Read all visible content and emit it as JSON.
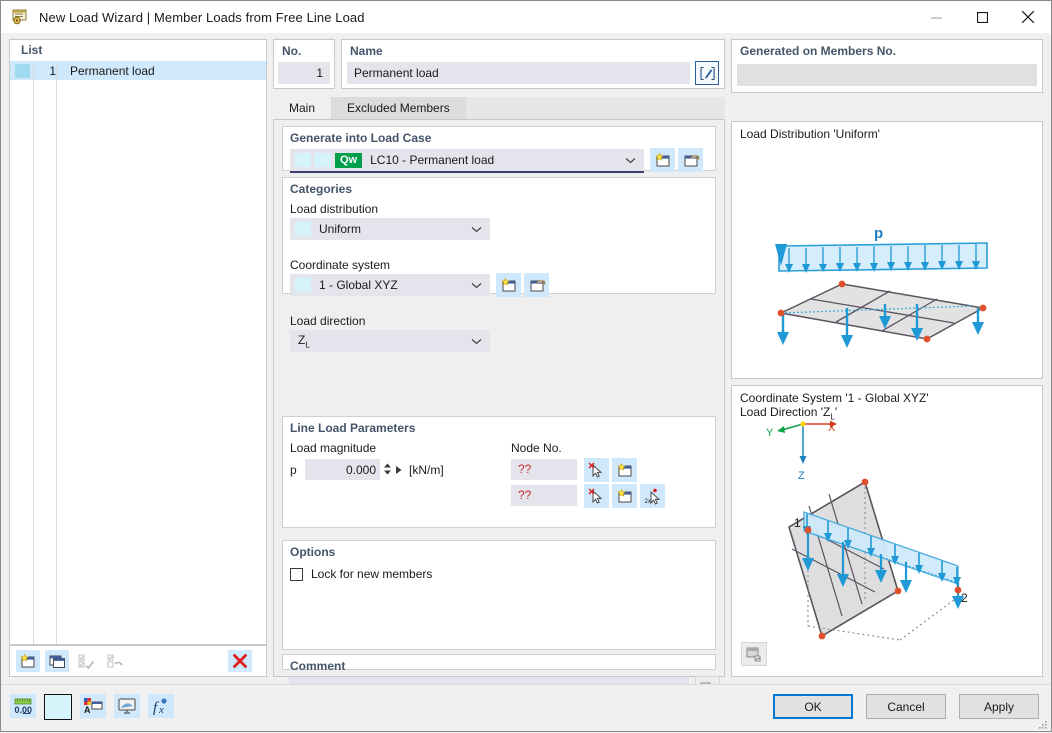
{
  "window": {
    "title": "New Load Wizard | Member Loads from Free Line Load",
    "icon": "load-wizard-icon",
    "minimize": "minimize-icon",
    "maximize": "maximize-icon",
    "close": "close-icon"
  },
  "list_panel": {
    "header": "List",
    "rows": [
      {
        "num": "1",
        "name": "Permanent load",
        "swatch": "#9fdcf2"
      }
    ],
    "toolbar": [
      {
        "name": "new-item-button",
        "icon": "new-window-star-icon",
        "enabled": true
      },
      {
        "name": "copy-item-button",
        "icon": "copy-window-icon",
        "enabled": true
      },
      {
        "name": "select-all-button",
        "icon": "checklist-check-icon",
        "enabled": false
      },
      {
        "name": "invert-selection-button",
        "icon": "checklist-invert-icon",
        "enabled": false
      },
      {
        "name": "delete-item-button",
        "icon": "red-x-icon",
        "enabled": true
      }
    ]
  },
  "header_fields": {
    "no_label": "No.",
    "no_value": "1",
    "name_label": "Name",
    "name_value": "Permanent load",
    "name_edit_icon": "edit-pencil-icon"
  },
  "tabs": [
    {
      "label": "Main",
      "selected": true
    },
    {
      "label": "Excluded Members",
      "selected": false
    }
  ],
  "generate_into_load_case": {
    "legend": "Generate into Load Case",
    "value": "LC10 - Permanent load",
    "badge": "Qw",
    "badge_color": "#00a04a",
    "swatch_color": "#d4f3fb",
    "chevron": "chevron-down-icon",
    "buttons": [
      {
        "name": "new-load-case-button",
        "icon": "new-window-star-icon"
      },
      {
        "name": "edit-load-case-button",
        "icon": "edit-window-icon"
      }
    ]
  },
  "categories": {
    "legend": "Categories",
    "load_distribution_label": "Load distribution",
    "load_distribution_value": "Uniform",
    "coordinate_system_label": "Coordinate system",
    "coordinate_system_value": "1 - Global XYZ",
    "coordinate_system_buttons": [
      {
        "name": "new-coordinate-system-button",
        "icon": "new-window-star-icon"
      },
      {
        "name": "edit-coordinate-system-button",
        "icon": "edit-window-icon"
      }
    ],
    "load_direction_label": "Load direction",
    "load_direction_value_main": "Z",
    "load_direction_value_sub": "L"
  },
  "line_load_parameters": {
    "legend": "Line Load Parameters",
    "load_magnitude_label": "Load magnitude",
    "p_symbol": "p",
    "p_value": "0.000",
    "p_unit": "[kN/m]",
    "node_no_label": "Node No.",
    "node_rows": [
      {
        "value": "??",
        "buttons": [
          {
            "name": "pick-node-1-button",
            "icon": "pick-cursor-icon"
          },
          {
            "name": "new-node-1-button",
            "icon": "new-window-star-icon"
          }
        ]
      },
      {
        "value": "??",
        "buttons": [
          {
            "name": "pick-node-2-button",
            "icon": "pick-cursor-icon"
          },
          {
            "name": "new-node-2-button",
            "icon": "new-window-star-icon"
          },
          {
            "name": "pick-two-nodes-button",
            "icon": "pick-two-points-icon"
          }
        ]
      }
    ]
  },
  "options": {
    "legend": "Options",
    "lock_label": "Lock for new members",
    "lock_checked": false
  },
  "comment": {
    "legend": "Comment",
    "value": "",
    "chevron": "chevron-down-icon",
    "button": {
      "name": "comment-library-button",
      "icon": "copy-pages-icon"
    }
  },
  "generated_on": {
    "legend": "Generated on Members No.",
    "value": ""
  },
  "preview_top": {
    "caption": "Load Distribution 'Uniform'",
    "load_symbol": "p"
  },
  "preview_bottom": {
    "caption_line1": "Coordinate System '1 - Global XYZ'",
    "caption_line2_prefix": "Load Direction '",
    "caption_line2_main": "Z",
    "caption_line2_sub": "L",
    "caption_line2_suffix": "'",
    "axis_x": "X",
    "axis_y": "Y",
    "axis_z": "Z",
    "node_label_1": "1",
    "node_label_2": "2",
    "snapshot_button": {
      "name": "preview-snapshot-button",
      "icon": "image-save-icon"
    }
  },
  "footer": {
    "tools": [
      {
        "name": "decimal-places-button",
        "icon": "number-format-icon",
        "label": "0.00"
      },
      {
        "name": "color-swatch-button",
        "icon": "color-swatch-icon"
      },
      {
        "name": "display-properties-button",
        "icon": "display-properties-icon"
      },
      {
        "name": "graphics-settings-button",
        "icon": "graphics-monitor-icon"
      },
      {
        "name": "formula-button",
        "icon": "formula-fx-icon"
      }
    ],
    "ok": "OK",
    "cancel": "Cancel",
    "apply": "Apply"
  }
}
